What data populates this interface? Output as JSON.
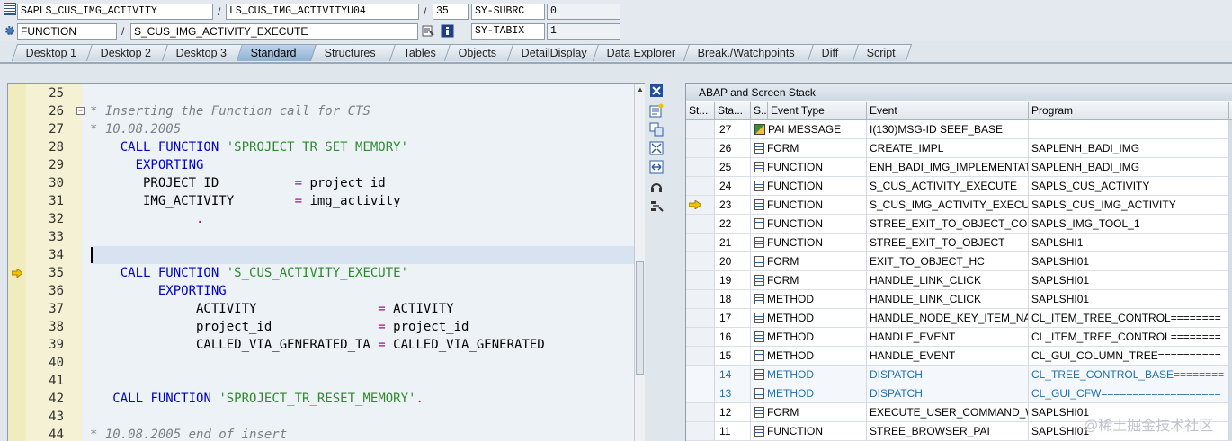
{
  "infobar": {
    "program": "SAPLS_CUS_IMG_ACTIVITY",
    "include": "LS_CUS_IMG_ACTIVITYU04",
    "line": "35",
    "var1_name": "SY-SUBRC",
    "var1_value": "0",
    "event_type": "FUNCTION",
    "event_name": "S_CUS_IMG_ACTIVITY_EXECUTE",
    "var2_name": "SY-TABIX",
    "var2_value": "1"
  },
  "tabs": [
    "Desktop 1",
    "Desktop 2",
    "Desktop 3",
    "Standard",
    "Structures",
    "Tables",
    "Objects",
    "DetailDisplay",
    "Data Explorer",
    "Break./Watchpoints",
    "Diff",
    "Script"
  ],
  "active_tab": "Standard",
  "code_lines": [
    {
      "n": "25",
      "html": ""
    },
    {
      "n": "26",
      "html": "<span class=\"cmt\">* Inserting the Function call for CTS</span>"
    },
    {
      "n": "27",
      "html": "<span class=\"cmt\">* 10.08.2005</span>"
    },
    {
      "n": "28",
      "html": "    <span class=\"kw\">CALL FUNCTION</span> <span class=\"str\">'SPROJECT_TR_SET_MEMORY'</span>"
    },
    {
      "n": "29",
      "html": "      <span class=\"kw\">EXPORTING</span>"
    },
    {
      "n": "30",
      "html": "       PROJECT_ID          <span class=\"op\">=</span> project_id"
    },
    {
      "n": "31",
      "html": "       IMG_ACTIVITY        <span class=\"op\">=</span> img_activity"
    },
    {
      "n": "32",
      "html": "              <span class=\"op\">.</span>"
    },
    {
      "n": "33",
      "html": ""
    },
    {
      "n": "34",
      "html": ""
    },
    {
      "n": "35",
      "html": "    <span class=\"kw\">CALL FUNCTION</span> <span class=\"str\">'S_CUS_ACTIVITY_EXECUTE'</span>"
    },
    {
      "n": "36",
      "html": "         <span class=\"kw\">EXPORTING</span>"
    },
    {
      "n": "37",
      "html": "              ACTIVITY                <span class=\"op\">=</span> ACTIVITY"
    },
    {
      "n": "38",
      "html": "              project_id              <span class=\"op\">=</span> project_id"
    },
    {
      "n": "39",
      "html": "              CALLED_VIA_GENERATED_TA <span class=\"op\">=</span> CALLED_VIA_GENERATED"
    },
    {
      "n": "40",
      "html": ""
    },
    {
      "n": "41",
      "html": ""
    },
    {
      "n": "42",
      "html": "   <span class=\"kw\">CALL FUNCTION</span> <span class=\"str\">'SPROJECT_TR_RESET_MEMORY'</span><span class=\"op\">.</span>"
    },
    {
      "n": "43",
      "html": ""
    },
    {
      "n": "44",
      "html": "<span class=\"cmt\">* 10.08.2005 end of insert</span>"
    }
  ],
  "stack": {
    "title": "ABAP and Screen Stack",
    "headers": [
      "St...",
      "Sta...",
      "S...",
      "Event Type",
      "Event",
      "Program"
    ],
    "rows": [
      {
        "level": "27",
        "type": "PAI MESSAGE",
        "event": "I(130)MSG-ID SEEF_BASE",
        "program": ""
      },
      {
        "level": "26",
        "type": "FORM",
        "event": "CREATE_IMPL",
        "program": "SAPLENH_BADI_IMG"
      },
      {
        "level": "25",
        "type": "FUNCTION",
        "event": "ENH_BADI_IMG_IMPLEMENTAT...",
        "program": "SAPLENH_BADI_IMG"
      },
      {
        "level": "24",
        "type": "FUNCTION",
        "event": "S_CUS_ACTIVITY_EXECUTE",
        "program": "SAPLS_CUS_ACTIVITY"
      },
      {
        "level": "23",
        "type": "FUNCTION",
        "event": "S_CUS_IMG_ACTIVITY_EXECU...",
        "program": "SAPLS_CUS_IMG_ACTIVITY"
      },
      {
        "level": "22",
        "type": "FUNCTION",
        "event": "STREE_EXIT_TO_OBJECT_COBJ",
        "program": "SAPLS_IMG_TOOL_1"
      },
      {
        "level": "21",
        "type": "FUNCTION",
        "event": "STREE_EXIT_TO_OBJECT",
        "program": "SAPLSHI1"
      },
      {
        "level": "20",
        "type": "FORM",
        "event": "EXIT_TO_OBJECT_HC",
        "program": "SAPLSHI01"
      },
      {
        "level": "19",
        "type": "FORM",
        "event": "HANDLE_LINK_CLICK",
        "program": "SAPLSHI01"
      },
      {
        "level": "18",
        "type": "METHOD",
        "event": "HANDLE_LINK_CLICK",
        "program": "SAPLSHI01"
      },
      {
        "level": "17",
        "type": "METHOD",
        "event": "HANDLE_NODE_KEY_ITEM_NA...",
        "program": "CL_ITEM_TREE_CONTROL========"
      },
      {
        "level": "16",
        "type": "METHOD",
        "event": "HANDLE_EVENT",
        "program": "CL_ITEM_TREE_CONTROL========"
      },
      {
        "level": "15",
        "type": "METHOD",
        "event": "HANDLE_EVENT",
        "program": "CL_GUI_COLUMN_TREE=========="
      },
      {
        "level": "14",
        "type": "METHOD",
        "event": "DISPATCH",
        "program": "CL_TREE_CONTROL_BASE========"
      },
      {
        "level": "13",
        "type": "METHOD",
        "event": "DISPATCH",
        "program": "CL_GUI_CFW==================="
      },
      {
        "level": "12",
        "type": "FORM",
        "event": "EXECUTE_USER_COMMAND_W...",
        "program": "SAPLSHI01"
      },
      {
        "level": "11",
        "type": "FUNCTION",
        "event": "STREE_BROWSER_PAI",
        "program": "SAPLSHI01"
      }
    ]
  },
  "watermark": "@稀土掘金技术社区",
  "colors": {
    "keyword": "#0000cc",
    "string": "#2d8a2d",
    "comment": "#7b7f86",
    "operator": "#a8127a",
    "blue_row": "#1f6fb2"
  }
}
